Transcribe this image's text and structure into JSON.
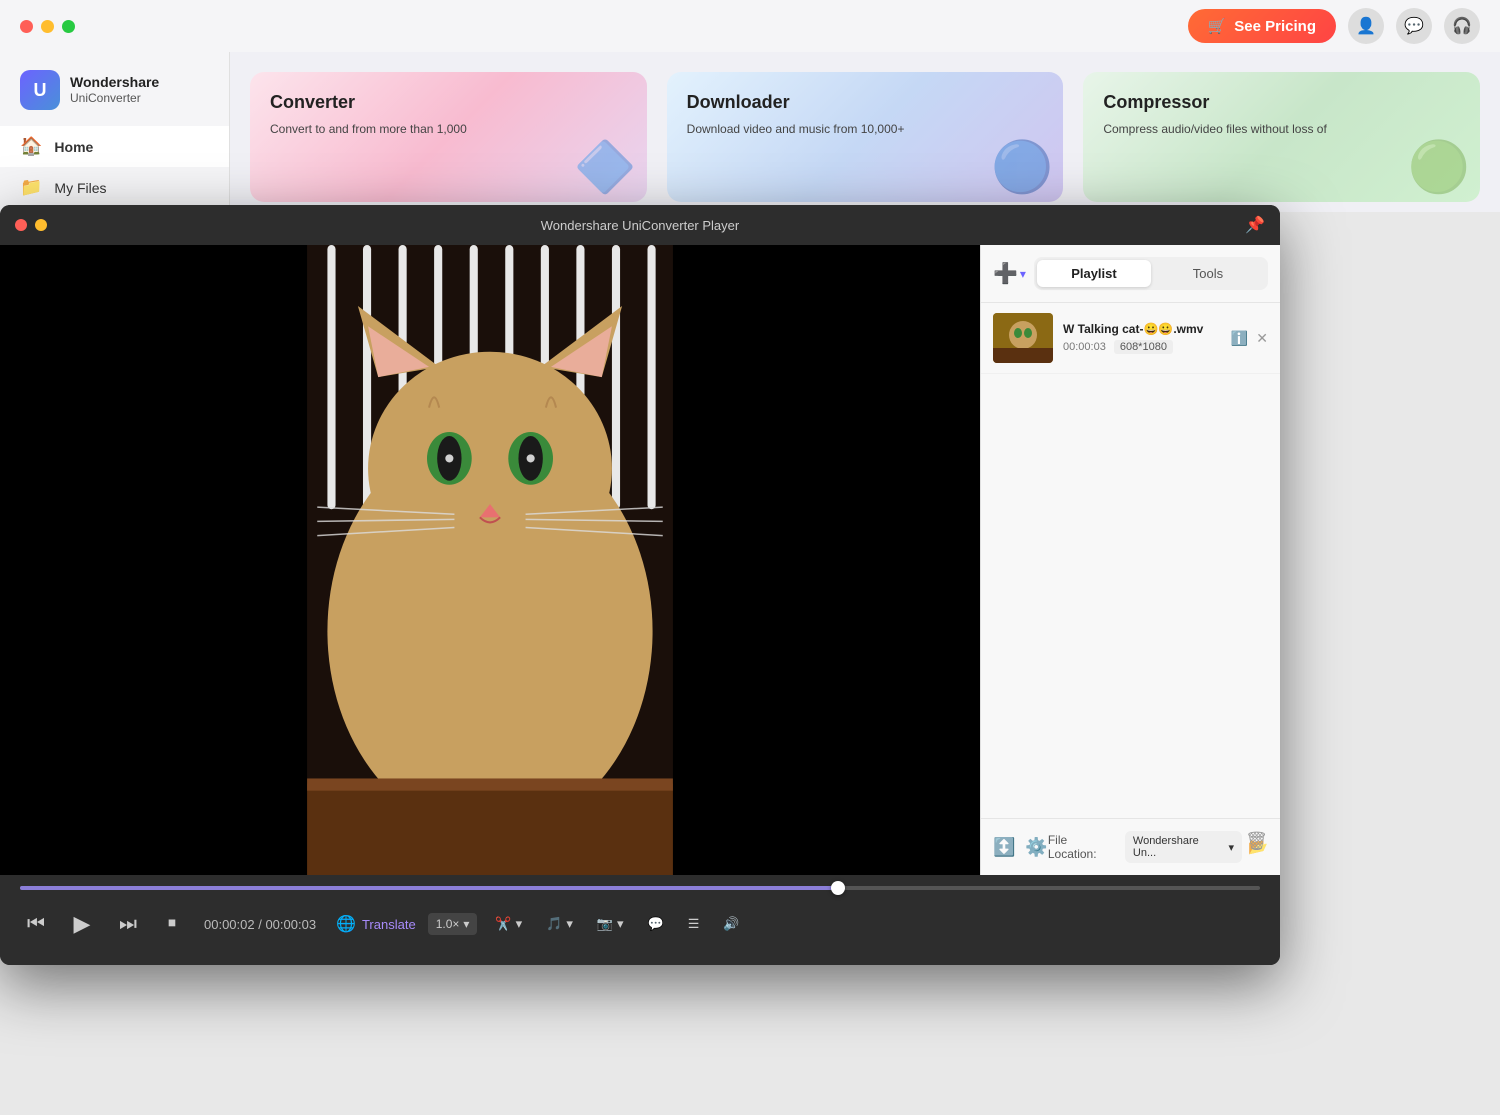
{
  "bg_app": {
    "traffic_lights": {
      "close": "●",
      "min": "●",
      "max": "●"
    },
    "brand": {
      "name": "Wondershare",
      "sub": "UniConverter"
    },
    "see_pricing_label": "See Pricing",
    "nav": {
      "home": "Home",
      "my_files": "My Files"
    },
    "cards": [
      {
        "id": "converter",
        "title": "Converter",
        "desc": "Convert to and from more than 1,000",
        "icon": "🔷"
      },
      {
        "id": "downloader",
        "title": "Downloader",
        "desc": "Download video and music from 10,000+",
        "icon": "🔵"
      },
      {
        "id": "compressor",
        "title": "Compressor",
        "desc": "Compress audio/video files without loss of",
        "icon": "🟢"
      }
    ]
  },
  "player": {
    "title": "Wondershare UniConverter Player",
    "tabs": {
      "playlist": "Playlist",
      "tools": "Tools"
    },
    "playlist_item": {
      "title": "W Talking cat-😀😀.wmv",
      "time": "00:00:03",
      "resolution": "608*1080"
    },
    "controls": {
      "time_current": "00:00:02",
      "time_total": "00:00:03",
      "time_display": "00:00:02 / 00:00:03",
      "translate_label": "Translate",
      "speed_label": "1.0×",
      "progress_percent": 66,
      "file_location_label": "File Location:",
      "file_location_value": "Wondershare Un...",
      "sort_label": "Sort"
    }
  }
}
